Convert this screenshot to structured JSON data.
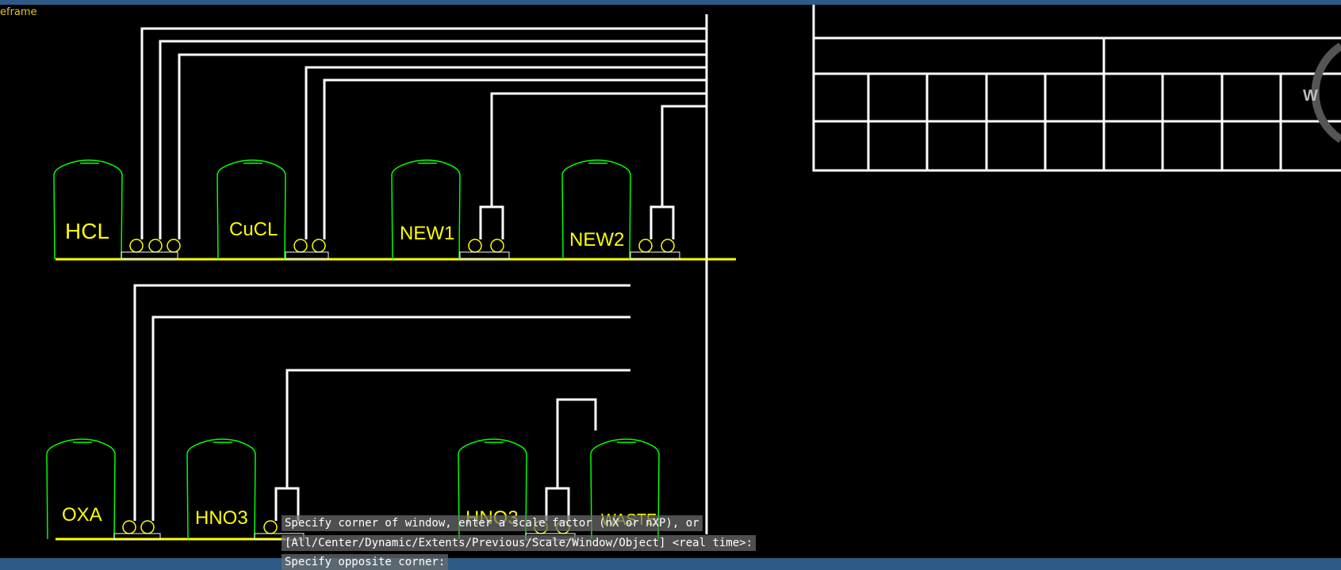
{
  "frame_label": "eframe",
  "viewcube": {
    "letter": "W"
  },
  "tanks": {
    "hcl": "HCL",
    "cucl": "CuCL",
    "new1": "NEW1",
    "new2": "NEW2",
    "oxa": "OXA",
    "hno3_a": "HNO3",
    "hno3_b": "HNO3",
    "waste": "WASTE"
  },
  "command_history": [
    "Specify corner of window, enter a scale factor (nX or nXP), or",
    "[All/Center/Dynamic/Extents/Previous/Scale/Window/Object] <real time>:",
    "Specify opposite corner:"
  ],
  "colors": {
    "background": "#000000",
    "window_frame": "#2d5a87",
    "tank_outline": "#00ff00",
    "pipe": "#ffffff",
    "floor_line": "#ffff00",
    "label": "#ffff00"
  }
}
